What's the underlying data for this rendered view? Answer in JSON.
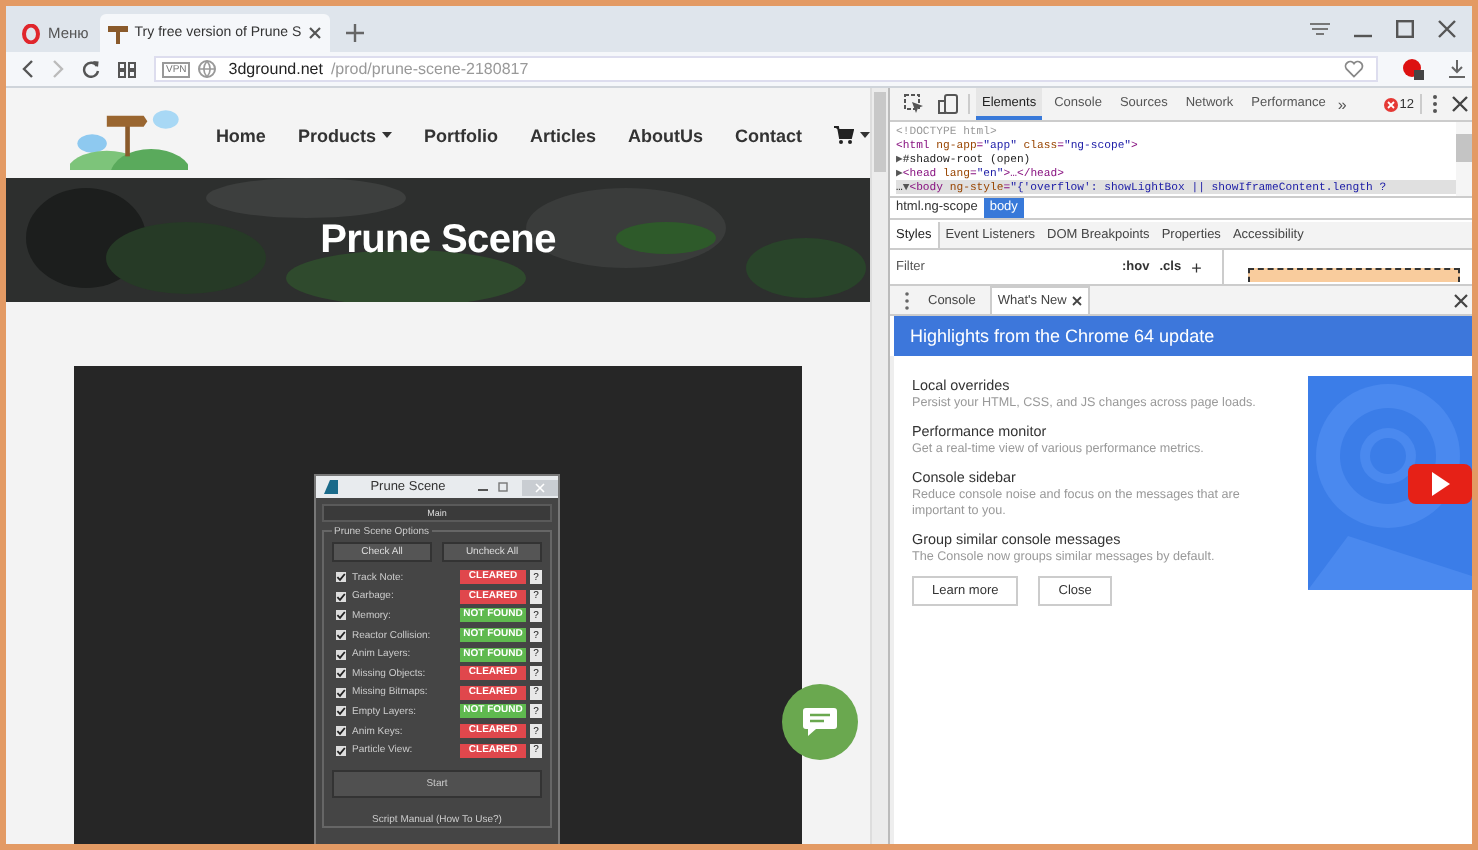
{
  "browser": {
    "tabs": [
      {
        "kind": "menu",
        "label": "Меню",
        "selected": false
      },
      {
        "kind": "page",
        "label": "Try free version of Prune S",
        "selected": true
      }
    ],
    "address": {
      "badge": "VPN",
      "domain": "3dground.net",
      "path": "/prod/prune-scene-2180817"
    }
  },
  "page": {
    "nav": [
      {
        "kind": "link",
        "label": "Home",
        "dropdown": false
      },
      {
        "kind": "link",
        "label": "Products",
        "dropdown": true
      },
      {
        "kind": "link",
        "label": "Portfolio",
        "dropdown": false
      },
      {
        "kind": "link",
        "label": "Articles",
        "dropdown": false
      },
      {
        "kind": "link",
        "label": "AboutUs",
        "dropdown": false
      },
      {
        "kind": "link",
        "label": "Contact",
        "dropdown": false
      },
      {
        "kind": "cart",
        "dropdown": true
      }
    ],
    "hero_title": "Prune Scene",
    "dialog": {
      "title": "Prune Scene",
      "rollout": "Main",
      "group": "Prune Scene Options",
      "buttons": [
        "Check All",
        "Uncheck All"
      ],
      "rows": [
        {
          "label": "Track Note:",
          "checked": true,
          "status": "CLEARED",
          "kind": "cleared",
          "help": "?"
        },
        {
          "label": "Garbage:",
          "checked": true,
          "status": "CLEARED",
          "kind": "cleared",
          "help": "?"
        },
        {
          "label": "Memory:",
          "checked": true,
          "status": "NOT FOUND",
          "kind": "not_found",
          "help": "?"
        },
        {
          "label": "Reactor Collision:",
          "checked": true,
          "status": "NOT FOUND",
          "kind": "not_found",
          "help": "?"
        },
        {
          "label": "Anim Layers:",
          "checked": true,
          "status": "NOT FOUND",
          "kind": "not_found",
          "help": "?"
        },
        {
          "label": "Missing Objects:",
          "checked": true,
          "status": "CLEARED",
          "kind": "cleared",
          "help": "?"
        },
        {
          "label": "Missing Bitmaps:",
          "checked": true,
          "status": "CLEARED",
          "kind": "cleared",
          "help": "?"
        },
        {
          "label": "Empty Layers:",
          "checked": true,
          "status": "NOT FOUND",
          "kind": "not_found",
          "help": "?"
        },
        {
          "label": "Anim Keys:",
          "checked": true,
          "status": "CLEARED",
          "kind": "cleared",
          "help": "?"
        },
        {
          "label": "Particle View:",
          "checked": true,
          "status": "CLEARED",
          "kind": "cleared",
          "help": "?"
        }
      ],
      "start": "Start",
      "manual": "Script Manual (How To Use?)"
    }
  },
  "devtools": {
    "tabs": [
      {
        "label": "Elements",
        "selected": true
      },
      {
        "label": "Console",
        "selected": false
      },
      {
        "label": "Sources",
        "selected": false
      },
      {
        "label": "Network",
        "selected": false
      },
      {
        "label": "Performance",
        "selected": false
      }
    ],
    "more": "»",
    "errors": "12",
    "dom": [
      {
        "selected": false,
        "tokens": [
          {
            "kind": "doctype",
            "text": "<!DOCTYPE html>"
          }
        ]
      },
      {
        "selected": false,
        "tokens": [
          {
            "kind": "tag",
            "text": "<html"
          },
          {
            "kind": "attr",
            "text": " ng-app"
          },
          {
            "kind": "tag",
            "text": "="
          },
          {
            "kind": "value",
            "text": "\"app\""
          },
          {
            "kind": "attr",
            "text": " class"
          },
          {
            "kind": "tag",
            "text": "="
          },
          {
            "kind": "value",
            "text": "\"ng-scope\""
          },
          {
            "kind": "tag",
            "text": ">"
          }
        ]
      },
      {
        "selected": false,
        "tokens": [
          {
            "kind": "arrow",
            "text": "▶"
          },
          {
            "kind": "text",
            "text": "#shadow-root (open)"
          }
        ]
      },
      {
        "selected": false,
        "tokens": [
          {
            "kind": "arrow",
            "text": "▶"
          },
          {
            "kind": "tag",
            "text": "<head"
          },
          {
            "kind": "attr",
            "text": " lang"
          },
          {
            "kind": "tag",
            "text": "="
          },
          {
            "kind": "value",
            "text": "\"en\""
          },
          {
            "kind": "tag",
            "text": ">…</head>"
          }
        ]
      },
      {
        "selected": true,
        "tokens": [
          {
            "kind": "text",
            "text": "…"
          },
          {
            "kind": "arrow",
            "text": "▼"
          },
          {
            "kind": "tag",
            "text": "<body"
          },
          {
            "kind": "attr",
            "text": " ng-style"
          },
          {
            "kind": "tag",
            "text": "="
          },
          {
            "kind": "value",
            "text": "\"{'overflow': showLightBox || showIframeContent.length ?"
          }
        ]
      }
    ],
    "breadcrumbs": [
      {
        "label": "html.ng-scope",
        "selected": false
      },
      {
        "label": "body",
        "selected": true
      }
    ],
    "style_tabs": [
      {
        "label": "Styles",
        "selected": true
      },
      {
        "label": "Event Listeners",
        "selected": false
      },
      {
        "label": "DOM Breakpoints",
        "selected": false
      },
      {
        "label": "Properties",
        "selected": false
      },
      {
        "label": "Accessibility",
        "selected": false
      }
    ],
    "filter": {
      "placeholder": "Filter",
      "hov": ":hov",
      "cls": ".cls",
      "add": "+"
    },
    "drawer_tabs": [
      {
        "label": "Console",
        "selected": false,
        "closable": false
      },
      {
        "label": "What's New",
        "selected": true,
        "closable": true
      }
    ],
    "whats_new": {
      "title": "Highlights from the Chrome 64 update",
      "features": [
        {
          "title": "Local overrides",
          "desc": "Persist your HTML, CSS, and JS changes across page loads."
        },
        {
          "title": "Performance monitor",
          "desc": "Get a real-time view of various performance metrics."
        },
        {
          "title": "Console sidebar",
          "desc": "Reduce console noise and focus on the messages that are important to you."
        },
        {
          "title": "Group similar console messages",
          "desc": "The Console now groups similar messages by default."
        }
      ],
      "buttons": [
        "Learn more",
        "Close"
      ]
    }
  }
}
